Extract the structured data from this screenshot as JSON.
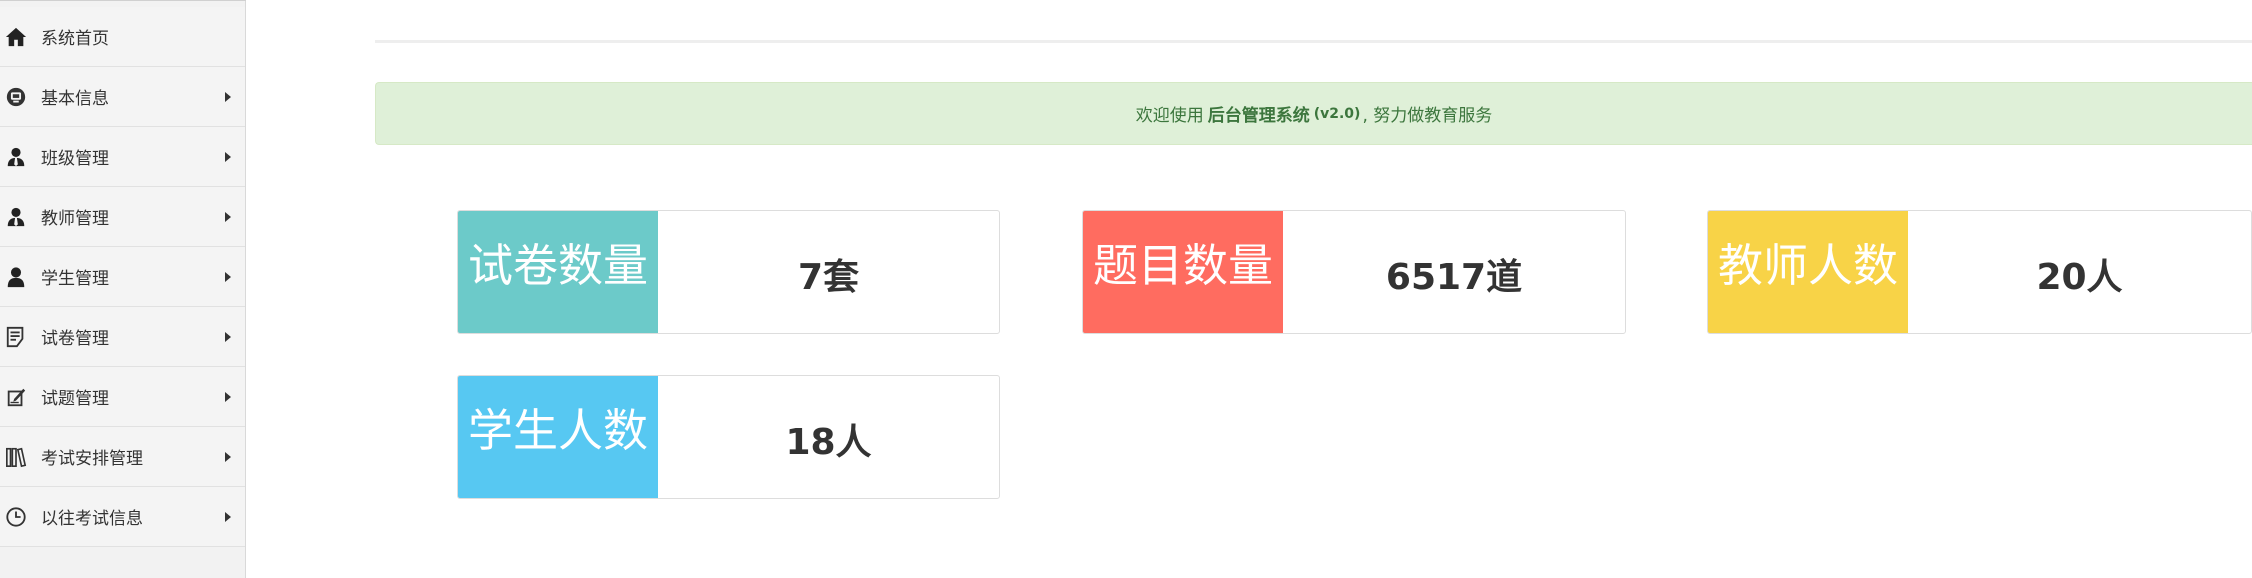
{
  "sidebar": {
    "items": [
      {
        "label": "系统首页",
        "icon": "home-icon",
        "has_submenu": false
      },
      {
        "label": "基本信息",
        "icon": "info-icon",
        "has_submenu": true
      },
      {
        "label": "班级管理",
        "icon": "user-tie-icon",
        "has_submenu": true
      },
      {
        "label": "教师管理",
        "icon": "user-tie-icon",
        "has_submenu": true
      },
      {
        "label": "学生管理",
        "icon": "user-icon",
        "has_submenu": true
      },
      {
        "label": "试卷管理",
        "icon": "document-icon",
        "has_submenu": true
      },
      {
        "label": "试题管理",
        "icon": "edit-icon",
        "has_submenu": true
      },
      {
        "label": "考试安排管理",
        "icon": "books-icon",
        "has_submenu": true
      },
      {
        "label": "以往考试信息",
        "icon": "clock-icon",
        "has_submenu": true
      }
    ]
  },
  "welcome": {
    "prefix": "欢迎使用",
    "system_name": "后台管理系统",
    "version": "(v2.0)",
    "suffix": ", 努力做教育服务"
  },
  "stats": [
    {
      "label": "试卷数量",
      "value": "7套",
      "color": "#6ccac9"
    },
    {
      "label": "题目数量",
      "value": "6517道",
      "color": "#ff6c60"
    },
    {
      "label": "教师人数",
      "value": "20人",
      "color": "#f8d347"
    },
    {
      "label": "学生人数",
      "value": "18人",
      "color": "#57c8f2"
    }
  ],
  "colors": {
    "sidebar_bg": "#f2f2f2",
    "alert_bg": "#dff0d8",
    "alert_text": "#3c763d"
  }
}
